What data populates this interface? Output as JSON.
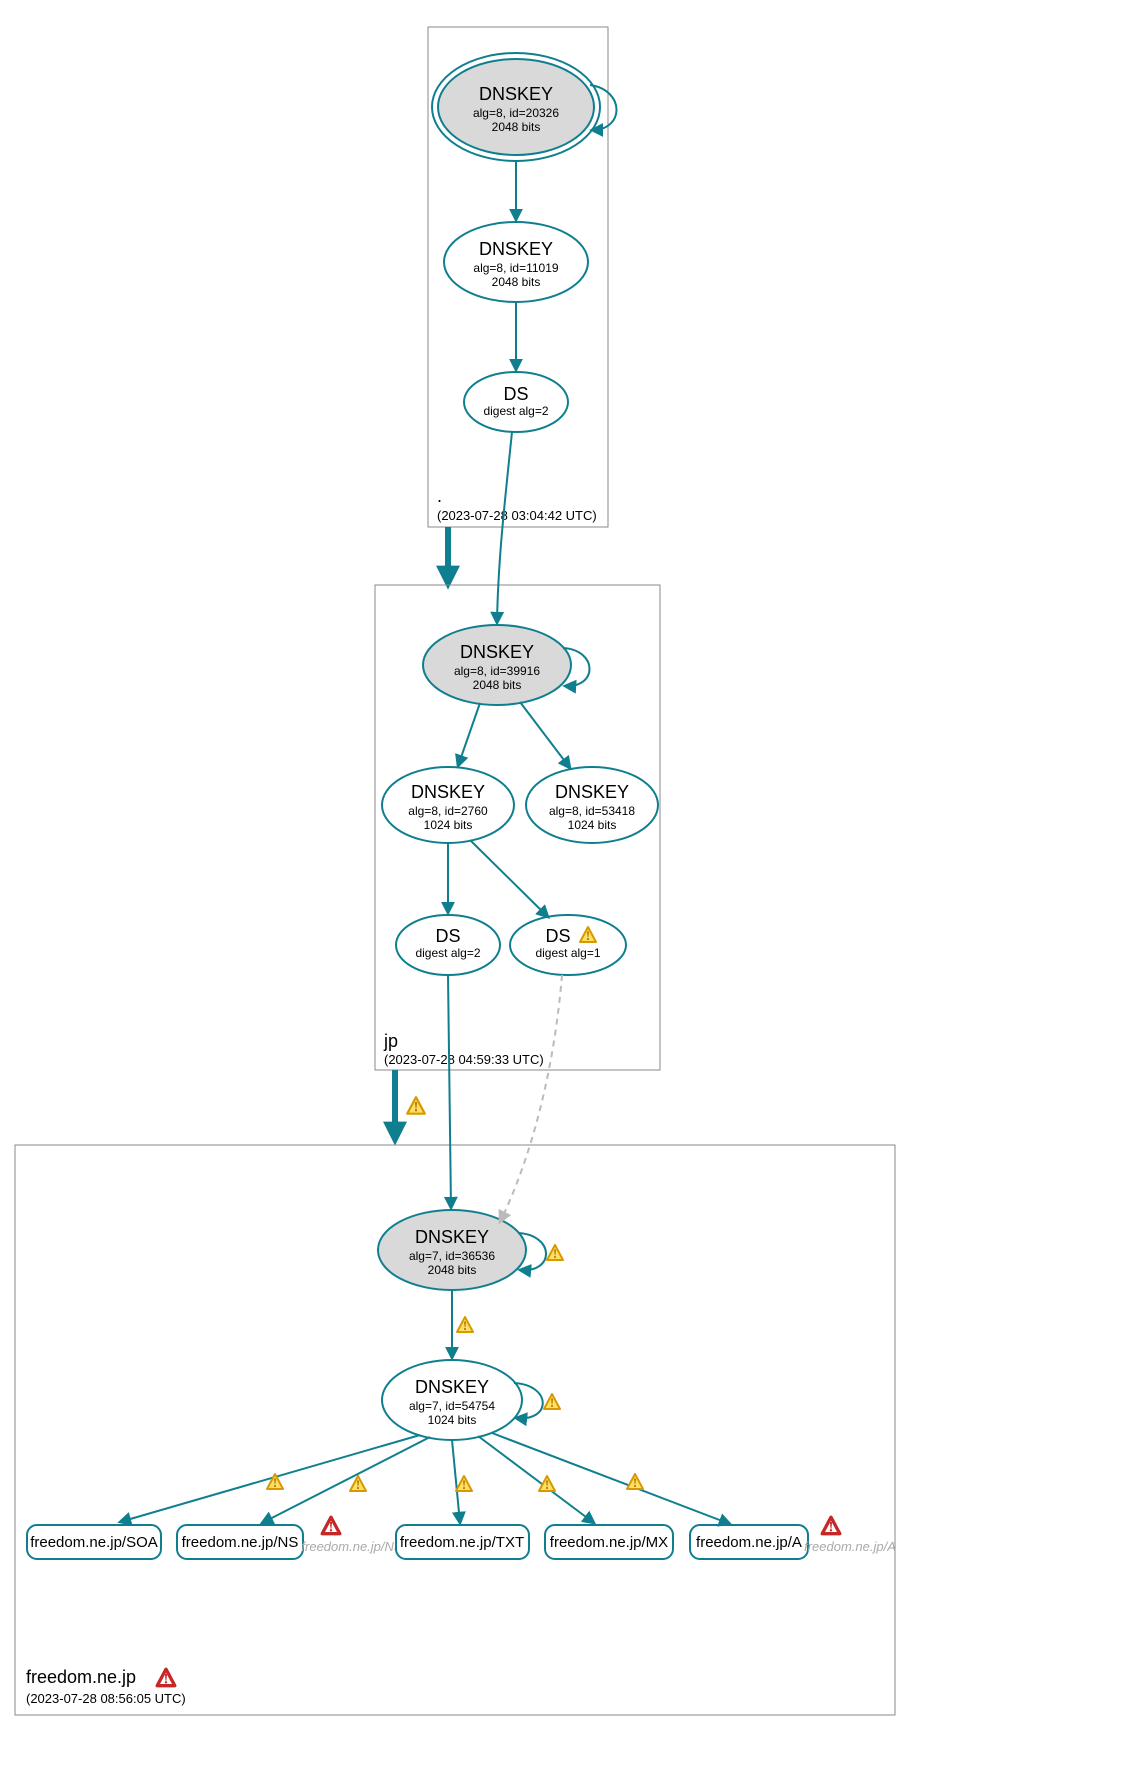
{
  "zones": {
    "root": {
      "label": ".",
      "timestamp": "(2023-07-28 03:04:42 UTC)"
    },
    "jp": {
      "label": "jp",
      "timestamp": "(2023-07-28 04:59:33 UTC)"
    },
    "leaf": {
      "label": "freedom.ne.jp",
      "timestamp": "(2023-07-28 08:56:05 UTC)"
    }
  },
  "nodes": {
    "root_ksk": {
      "title": "DNSKEY",
      "sub1": "alg=8, id=20326",
      "sub2": "2048 bits"
    },
    "root_zsk": {
      "title": "DNSKEY",
      "sub1": "alg=8, id=11019",
      "sub2": "2048 bits"
    },
    "root_ds": {
      "title": "DS",
      "sub1": "digest alg=2"
    },
    "jp_ksk": {
      "title": "DNSKEY",
      "sub1": "alg=8, id=39916",
      "sub2": "2048 bits"
    },
    "jp_zsk1": {
      "title": "DNSKEY",
      "sub1": "alg=8, id=2760",
      "sub2": "1024 bits"
    },
    "jp_zsk2": {
      "title": "DNSKEY",
      "sub1": "alg=8, id=53418",
      "sub2": "1024 bits"
    },
    "jp_ds1": {
      "title": "DS",
      "sub1": "digest alg=2"
    },
    "jp_ds2": {
      "title": "DS",
      "sub1": "digest alg=1"
    },
    "leaf_ksk": {
      "title": "DNSKEY",
      "sub1": "alg=7, id=36536",
      "sub2": "2048 bits"
    },
    "leaf_zsk": {
      "title": "DNSKEY",
      "sub1": "alg=7, id=54754",
      "sub2": "1024 bits"
    }
  },
  "records": {
    "soa": "freedom.ne.jp/SOA",
    "ns": "freedom.ne.jp/NS",
    "txt": "freedom.ne.jp/TXT",
    "mx": "freedom.ne.jp/MX",
    "a": "freedom.ne.jp/A"
  },
  "faded": {
    "ns": "freedom.ne.jp/NS",
    "a": "freedom.ne.jp/A"
  }
}
